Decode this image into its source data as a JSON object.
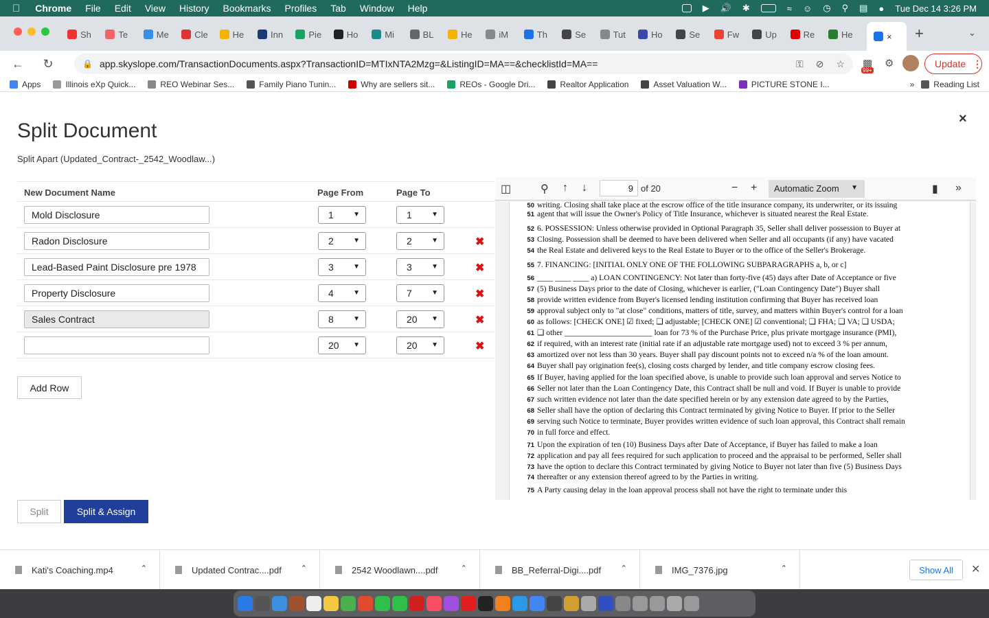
{
  "menubar": {
    "app": "Chrome",
    "items": [
      "File",
      "Edit",
      "View",
      "History",
      "Bookmarks",
      "Profiles",
      "Tab",
      "Window",
      "Help"
    ],
    "datetime": "Tue Dec 14  3:26 PM"
  },
  "tabs": [
    {
      "label": "Sh",
      "color": "#e33"
    },
    {
      "label": "Te",
      "color": "#e66"
    },
    {
      "label": "Me",
      "color": "#3a8ee6"
    },
    {
      "label": "Cle",
      "color": "#d33"
    },
    {
      "label": "He",
      "color": "#f2b400"
    },
    {
      "label": "Inn",
      "color": "#1b3a7a"
    },
    {
      "label": "Pie",
      "color": "#1aa260"
    },
    {
      "label": "Ho",
      "color": "#222"
    },
    {
      "label": "Mi",
      "color": "#1d8a8a"
    },
    {
      "label": "BL",
      "color": "#666"
    },
    {
      "label": "He",
      "color": "#f2b400"
    },
    {
      "label": "iM",
      "color": "#888"
    },
    {
      "label": "Th",
      "color": "#1a73e8"
    },
    {
      "label": "Se",
      "color": "#444"
    },
    {
      "label": "Tut",
      "color": "#888"
    },
    {
      "label": "Ho",
      "color": "#3949ab"
    },
    {
      "label": "Se",
      "color": "#444"
    },
    {
      "label": "Fw",
      "color": "#ea4335"
    },
    {
      "label": "Up",
      "color": "#444"
    },
    {
      "label": "Re",
      "color": "#d00"
    },
    {
      "label": "He",
      "color": "#2a7d2e"
    }
  ],
  "active_tab_close": "×",
  "address": {
    "url": "app.skyslope.com/TransactionDocuments.aspx?TransactionID=MTIxNTA2Mzg=&ListingID=MA==&checklistId=MA=="
  },
  "update_label": "Update",
  "notification_badge": "99+",
  "bookmarks": [
    {
      "label": "Apps",
      "color": "#4285f4"
    },
    {
      "label": "Illinois eXp Quick...",
      "color": "#999"
    },
    {
      "label": "REO Webinar Ses...",
      "color": "#888"
    },
    {
      "label": "Family Piano Tunin...",
      "color": "#555"
    },
    {
      "label": "Why are sellers sit...",
      "color": "#c00"
    },
    {
      "label": "REOs - Google Dri...",
      "color": "#1aa260"
    },
    {
      "label": "Realtor Application",
      "color": "#444"
    },
    {
      "label": "Asset Valuation W...",
      "color": "#444"
    },
    {
      "label": "PICTURE STONE I...",
      "color": "#7b2fbf"
    }
  ],
  "bookmarks_more": "»",
  "reading_list": "Reading List",
  "page": {
    "title": "Split Document",
    "subtitle": "Split Apart (Updated_Contract-_2542_Woodlaw...)",
    "close": "×",
    "headers": {
      "name": "New Document Name",
      "from": "Page From",
      "to": "Page To"
    },
    "rows": [
      {
        "name": "Mold Disclosure",
        "from": "1",
        "to": "1",
        "deletable": false
      },
      {
        "name": "Radon Disclosure",
        "from": "2",
        "to": "2",
        "deletable": true
      },
      {
        "name": "Lead-Based Paint Disclosure pre 1978",
        "from": "3",
        "to": "3",
        "deletable": true
      },
      {
        "name": "Property Disclosure",
        "from": "4",
        "to": "7",
        "deletable": true
      },
      {
        "name": "Sales Contract",
        "from": "8",
        "to": "20",
        "deletable": true
      },
      {
        "name": "",
        "from": "20",
        "to": "20",
        "deletable": true
      }
    ],
    "delete_glyph": "✖",
    "add_row": "Add Row",
    "split": "Split",
    "split_assign": "Split & Assign"
  },
  "pdf": {
    "page": "9",
    "of": "of 20",
    "zoom": "Automatic Zoom",
    "lines": [
      {
        "n": "50",
        "t": "writing. Closing shall take place at the escrow office of the title insurance company, its underwriter, or its issuing"
      },
      {
        "n": "51",
        "t": "agent that will issue the Owner's Policy of Title Insurance, whichever is situated nearest the Real Estate."
      },
      {
        "n": "52",
        "t": "6. POSSESSION: Unless otherwise provided in Optional Paragraph 35, Seller shall deliver possession to Buyer at"
      },
      {
        "n": "53",
        "t": "Closing. Possession shall be deemed to have been delivered when Seller and all occupants (if any) have vacated"
      },
      {
        "n": "54",
        "t": "the Real Estate and delivered keys to the Real Estate to Buyer or to the office of the Seller's Brokerage."
      },
      {
        "n": "55",
        "t": "7. FINANCING: [INITIAL ONLY ONE OF THE FOLLOWING SUBPARAGRAPHS a, b, or c]"
      },
      {
        "n": "56",
        "t": "____ ____ ____ a) LOAN CONTINGENCY: Not later than forty-five (45) days after Date of Acceptance or five"
      },
      {
        "n": "57",
        "t": "(5) Business Days prior to the date of Closing, whichever is earlier, (\"Loan Contingency Date\") Buyer shall"
      },
      {
        "n": "58",
        "t": "provide written evidence from Buyer's licensed lending institution confirming that Buyer has received loan"
      },
      {
        "n": "59",
        "t": "approval subject only to \"at close\" conditions, matters of title, survey, and matters within Buyer's control for a loan"
      },
      {
        "n": "60",
        "t": "as follows: [CHECK ONE] ☑ fixed; ❑ adjustable; [CHECK ONE] ☑ conventional; ❑ FHA; ❑ VA; ❑ USDA;"
      },
      {
        "n": "61",
        "t": "❑ other ______________________ loan for 73 % of the Purchase Price, plus private mortgage insurance (PMI),"
      },
      {
        "n": "62",
        "t": "if required, with an interest rate (initial rate if an adjustable rate mortgage used) not to exceed 3 % per annum,"
      },
      {
        "n": "63",
        "t": "amortized over not less than 30 years. Buyer shall pay discount points not to exceed n/a % of the loan amount."
      },
      {
        "n": "64",
        "t": "Buyer shall pay origination fee(s), closing costs charged by lender, and title company escrow closing fees."
      },
      {
        "n": "65",
        "t": "If Buyer, having applied for the loan specified above, is unable to provide such loan approval and serves Notice to"
      },
      {
        "n": "66",
        "t": "Seller not later than the Loan Contingency Date, this Contract shall be null and void. If Buyer is unable to provide"
      },
      {
        "n": "67",
        "t": "such written evidence not later than the date specified herein or by any extension date agreed to by the Parties,"
      },
      {
        "n": "68",
        "t": "Seller shall have the option of declaring this Contract terminated by giving Notice to Buyer. If prior to the Seller"
      },
      {
        "n": "69",
        "t": "serving such Notice to terminate, Buyer provides written evidence of such loan approval, this Contract shall remain"
      },
      {
        "n": "70",
        "t": "in full force and effect."
      },
      {
        "n": "71",
        "t": "Upon the expiration of ten (10) Business Days after Date of Acceptance, if Buyer has failed to make a loan"
      },
      {
        "n": "72",
        "t": "application and pay all fees required for such application to proceed and the appraisal to be performed, Seller shall"
      },
      {
        "n": "73",
        "t": "have the option to declare this Contract terminated by giving Notice to Buyer not later than five (5) Business Days"
      },
      {
        "n": "74",
        "t": "thereafter or any extension thereof agreed to by the Parties in writing."
      },
      {
        "n": "75",
        "t": "A Party causing delay in the loan approval process shall not have the right to terminate under this"
      }
    ]
  },
  "downloads": [
    {
      "label": "Kati's Coaching.mp4"
    },
    {
      "label": "Updated Contrac....pdf"
    },
    {
      "label": "2542 Woodlawn....pdf"
    },
    {
      "label": "BB_Referral-Digi....pdf"
    },
    {
      "label": "IMG_7376.jpg"
    }
  ],
  "show_all": "Show All",
  "dock_colors": [
    "#2a7be4",
    "#555",
    "#3d8fe0",
    "#a0522d",
    "#eee",
    "#f5c842",
    "#49b04d",
    "#e04a2f",
    "#2fbf4a",
    "#2fbf4a",
    "#d02020",
    "#fa4e62",
    "#a050e0",
    "#e02020",
    "#222",
    "#f08020",
    "#2a9ae8",
    "#4285f4",
    "#444",
    "#d0a030",
    "#aaa",
    "#3050c0",
    "#888",
    "#999",
    "#999",
    "#aaa",
    "#999"
  ]
}
